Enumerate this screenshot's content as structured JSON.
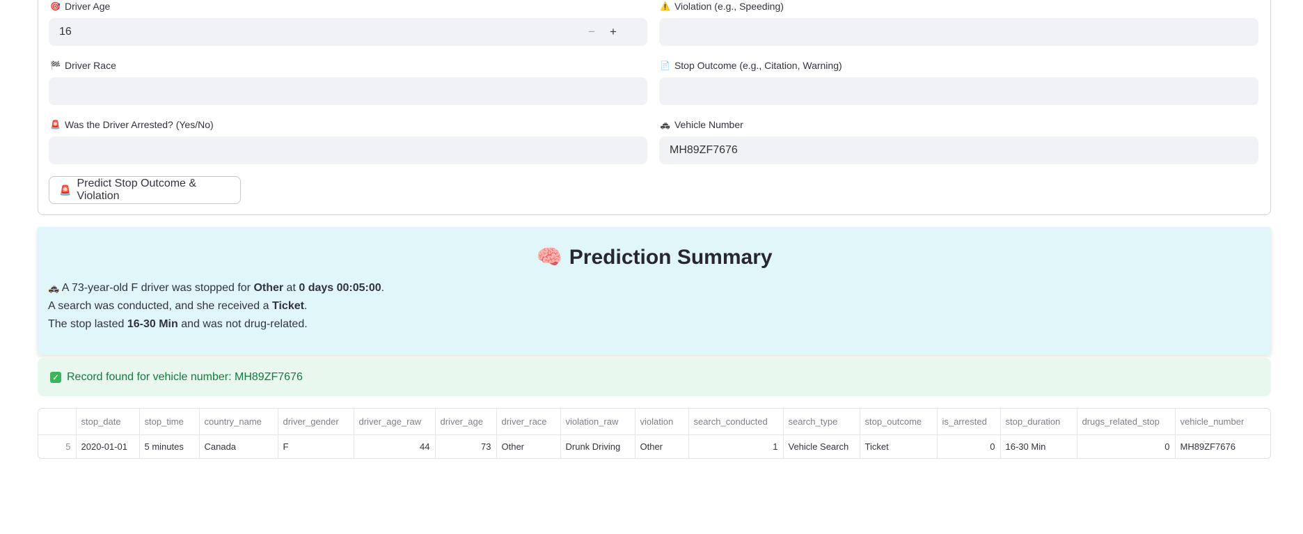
{
  "form": {
    "driver_age": {
      "icon": "🎯",
      "label": "Driver Age",
      "value": "16",
      "minus": "−",
      "plus": "+"
    },
    "violation": {
      "icon": "⚠️",
      "label": "Violation (e.g., Speeding)",
      "value": ""
    },
    "driver_race": {
      "icon": "🏁",
      "label": "Driver Race",
      "value": ""
    },
    "stop_outcome": {
      "icon": "📄",
      "label": "Stop Outcome (e.g., Citation, Warning)",
      "value": ""
    },
    "arrested": {
      "icon": "🚨",
      "label": "Was the Driver Arrested? (Yes/No)",
      "value": ""
    },
    "vehicle_number": {
      "icon": "🚓",
      "label": "Vehicle Number",
      "value": "MH89ZF7676"
    },
    "predict_button": {
      "icon": "🚨",
      "label": "Predict Stop Outcome & Violation"
    }
  },
  "summary": {
    "icon": "🧠",
    "title": "Prediction Summary",
    "line1": {
      "icon": "🚓",
      "pre": " A 73-year-old F driver was stopped for ",
      "b1": "Other",
      "mid": " at ",
      "b2": "0 days 00:05:00",
      "post": "."
    },
    "line2": {
      "pre": "A search was conducted, and she received a ",
      "b1": "Ticket",
      "post": "."
    },
    "line3": {
      "pre": "The stop lasted ",
      "b1": "16-30 Min",
      "post": " and was not drug-related."
    }
  },
  "success": {
    "check": "✓",
    "text": "Record found for vehicle number: MH89ZF7676"
  },
  "table": {
    "columns": [
      "",
      "stop_date",
      "stop_time",
      "country_name",
      "driver_gender",
      "driver_age_raw",
      "driver_age",
      "driver_race",
      "violation_raw",
      "violation",
      "search_conducted",
      "search_type",
      "stop_outcome",
      "is_arrested",
      "stop_duration",
      "drugs_related_stop",
      "vehicle_number"
    ],
    "rows": [
      [
        "5",
        "2020-01-01",
        "5 minutes",
        "Canada",
        "F",
        "44",
        "73",
        "Other",
        "Drunk Driving",
        "Other",
        "1",
        "Vehicle Search",
        "Ticket",
        "0",
        "16-30 Min",
        "0",
        "MH89ZF7676"
      ]
    ]
  }
}
